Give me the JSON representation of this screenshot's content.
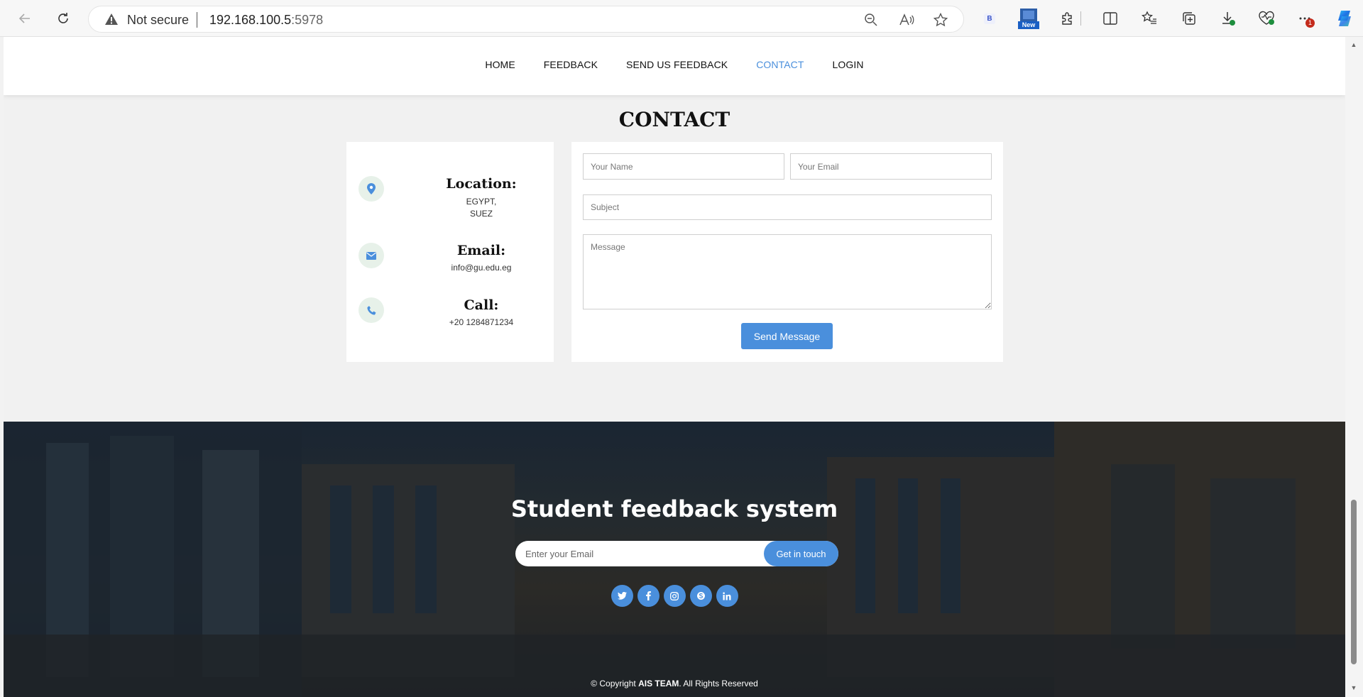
{
  "browser": {
    "security_label": "Not secure",
    "url_host": "192.168.100.5",
    "url_port": ":5978",
    "new_badge": "New",
    "extension_label": "B",
    "downloads_badge": "1"
  },
  "nav": {
    "items": [
      {
        "label": "HOME"
      },
      {
        "label": "FEEDBACK"
      },
      {
        "label": "SEND US FEEDBACK"
      },
      {
        "label": "CONTACT",
        "active": true
      },
      {
        "label": "LOGIN"
      }
    ]
  },
  "contact": {
    "title": "CONTACT",
    "location": {
      "heading": "Location:",
      "line1": "EGYPT,",
      "line2": "SUEZ",
      "icon": "map-marker-icon"
    },
    "email": {
      "heading": "Email:",
      "value": "info@gu.edu.eg",
      "icon": "envelope-icon"
    },
    "call": {
      "heading": "Call:",
      "value": "+20 1284871234",
      "icon": "phone-icon"
    },
    "form": {
      "name_placeholder": "Your Name",
      "email_placeholder": "Your Email",
      "subject_placeholder": "Subject",
      "message_placeholder": "Message",
      "submit_label": "Send Message"
    }
  },
  "footer": {
    "title": "Student feedback system",
    "subscribe_placeholder": "Enter your Email",
    "subscribe_button": "Get in touch",
    "socials": [
      "twitter-icon",
      "facebook-icon",
      "instagram-icon",
      "skype-icon",
      "linkedin-icon"
    ],
    "copyright_prefix": "© Copyright ",
    "copyright_brand": "AIS TEAM",
    "copyright_suffix": ". All Rights Reserved"
  },
  "colors": {
    "accent": "#4a8fdc",
    "footer_bg": "#222a30",
    "icon_circle": "#e7f1e9"
  }
}
